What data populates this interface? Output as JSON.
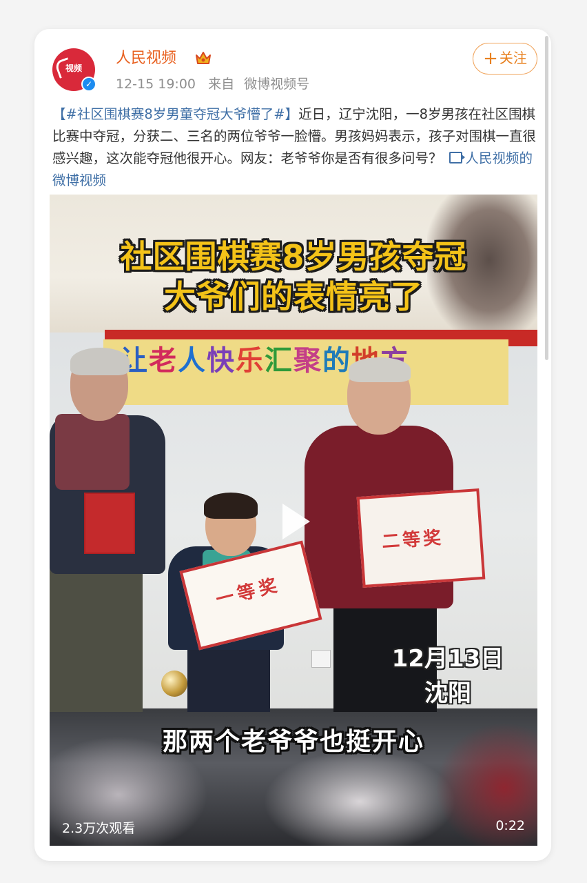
{
  "post": {
    "username": "人民视频",
    "avatar_logo_text": "视频",
    "time": "12-15 19:00",
    "from_label": "来自",
    "source": "微博视频号",
    "follow_label": "关注",
    "text_hashtag": "【#社区围棋赛8岁男童夺冠大爷懵了#】",
    "text_body": "近日，辽宁沈阳，一8岁男孩在社区围棋比赛中夺冠，分获二、三名的两位爷爷一脸懵。男孩妈妈表示，孩子对围棋一直很感兴趣，这次能夺冠他很开心。网友：老爷爷你是否有很多问号？",
    "video_link": "人民视频的微博视频"
  },
  "video": {
    "title_line1": "社区围棋赛8岁男孩夺冠",
    "title_line2": "大爷们的表情亮了",
    "banner_chars": [
      "让",
      "老",
      "人",
      "快",
      "乐",
      "汇",
      "聚",
      "的",
      "地",
      "方"
    ],
    "cert_center_text": "二等奖",
    "cert_kid_text": "一等奖",
    "date_line1": "12月13日",
    "date_line2": "沈阳",
    "subtitle": "那两个老爷爷也挺开心",
    "views": "2.3万次观看",
    "duration": "0:22"
  },
  "colors": {
    "username": "#e8601f",
    "hashtag_link": "#3f6fa6",
    "title_yellow": "#f4c318",
    "avatar_red": "#d9293a",
    "verified_blue": "#1d8cf0"
  },
  "icons": {
    "verified": "verified-check-icon",
    "crown": "crown-badge-icon",
    "plus": "plus-icon",
    "video_link": "video-camera-icon",
    "play": "play-icon"
  }
}
